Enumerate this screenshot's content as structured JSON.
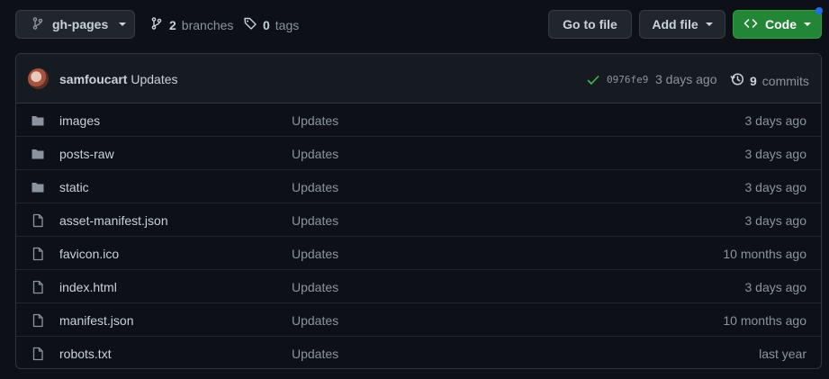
{
  "branch": {
    "name": "gh-pages"
  },
  "meta": {
    "branches_count": "2",
    "branches_label": "branches",
    "tags_count": "0",
    "tags_label": "tags"
  },
  "actions": {
    "goto_label": "Go to file",
    "addfile_label": "Add file",
    "code_label": "Code"
  },
  "commit": {
    "author": "samfoucart",
    "message": "Updates",
    "sha": "0976fe9",
    "time": "3 days ago",
    "commits_count": "9",
    "commits_label": "commits"
  },
  "files": [
    {
      "type": "folder",
      "name": "images",
      "message": "Updates",
      "time": "3 days ago"
    },
    {
      "type": "folder",
      "name": "posts-raw",
      "message": "Updates",
      "time": "3 days ago"
    },
    {
      "type": "folder",
      "name": "static",
      "message": "Updates",
      "time": "3 days ago"
    },
    {
      "type": "file",
      "name": "asset-manifest.json",
      "message": "Updates",
      "time": "3 days ago"
    },
    {
      "type": "file",
      "name": "favicon.ico",
      "message": "Updates",
      "time": "10 months ago"
    },
    {
      "type": "file",
      "name": "index.html",
      "message": "Updates",
      "time": "3 days ago"
    },
    {
      "type": "file",
      "name": "manifest.json",
      "message": "Updates",
      "time": "10 months ago"
    },
    {
      "type": "file",
      "name": "robots.txt",
      "message": "Updates",
      "time": "last year"
    }
  ],
  "colors": {
    "accent_green": "#238636",
    "check_green": "#3fb950",
    "icon_gray": "#8b949e",
    "notif_blue": "#1f6feb"
  }
}
